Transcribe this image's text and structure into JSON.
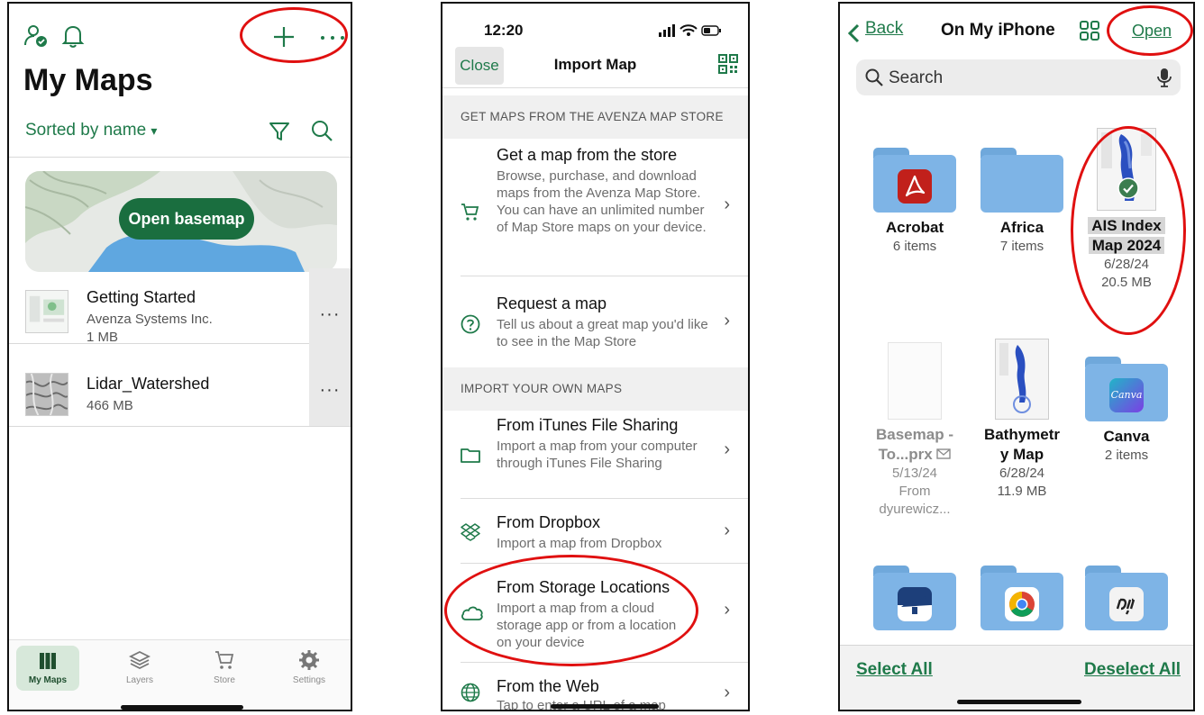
{
  "colors": {
    "accent": "#1f7a4a",
    "annotation": "#e01010",
    "folder": "#7eb4e6"
  },
  "panel1": {
    "header_icons": [
      "user-check-icon",
      "bell-icon",
      "plus-icon",
      "more-icon"
    ],
    "title": "My Maps",
    "sort_label": "Sorted by name",
    "sort_caret": "▾",
    "basemap_button": "Open basemap",
    "maps": [
      {
        "name": "Getting Started",
        "owner": "Avenza Systems Inc.",
        "size": "1 MB"
      },
      {
        "name": "Lidar_Watershed",
        "size": "466 MB"
      }
    ],
    "row_more": "···",
    "tabs": [
      {
        "label": "My Maps",
        "icon": "map-icon",
        "active": true
      },
      {
        "label": "Layers",
        "icon": "layers-icon"
      },
      {
        "label": "Store",
        "icon": "cart-icon"
      },
      {
        "label": "Settings",
        "icon": "gear-icon"
      }
    ]
  },
  "panel2": {
    "time": "12:20",
    "close": "Close",
    "title": "Import Map",
    "section_store": "GET MAPS FROM THE AVENZA MAP STORE",
    "section_own": "IMPORT YOUR OWN MAPS",
    "chevron": "›",
    "options": {
      "store": {
        "title": "Get a map from the store",
        "desc": "Browse, purchase, and download maps from the Avenza Map Store. You can have an unlimited number of Map Store maps on your device."
      },
      "request": {
        "title": "Request a map",
        "desc": "Tell us about a great map you'd like to see in the Map Store"
      },
      "itunes": {
        "title": "From iTunes File Sharing",
        "desc": "Import a map from your computer through iTunes File Sharing"
      },
      "dropbox": {
        "title": "From Dropbox",
        "desc": "Import a map from Dropbox"
      },
      "storage": {
        "title": "From Storage Locations",
        "desc": "Import a map from a cloud storage app or from a location on your device"
      },
      "web": {
        "title": "From the Web",
        "desc": "Tap to enter a URL of a map"
      }
    }
  },
  "panel3": {
    "back": "Back",
    "location": "On My iPhone",
    "open": "Open",
    "search_placeholder": "Search",
    "items": {
      "acrobat": {
        "name": "Acrobat",
        "meta": "6 items"
      },
      "africa": {
        "name": "Africa",
        "meta": "7 items"
      },
      "ais": {
        "name": "AIS Index Map 2024",
        "name_l1": "AIS Index",
        "name_l2": "Map 2024",
        "date": "6/28/24",
        "size": "20.5 MB"
      },
      "basemap": {
        "name_l1": "Basemap -",
        "name_l2": "To...prx",
        "date": "5/13/24",
        "from": "From",
        "from_who": "dyurewicz..."
      },
      "bathy": {
        "name_l1": "Bathymetr",
        "name_l2": "y Map",
        "date": "6/28/24",
        "size": "11.9 MB"
      },
      "canva": {
        "name": "Canva",
        "meta": "2 items",
        "badge": "Canva"
      }
    },
    "select_all": "Select All",
    "deselect_all": "Deselect All"
  }
}
